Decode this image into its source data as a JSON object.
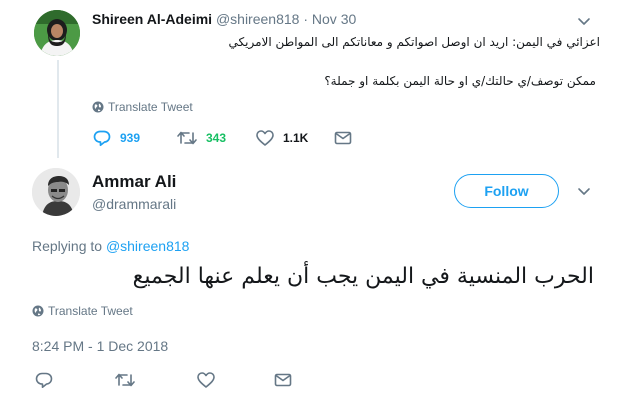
{
  "parent_tweet": {
    "author_name": "Shireen Al-Adeimi",
    "handle": "@shireen818",
    "separator": "·",
    "date": "Nov 30",
    "text_line1": "اعزائي في اليمن: اريد ان اوصل اصواتكم و معاناتكم الى المواطن الامريكي",
    "text_line2": "ممكن توصف/ي حالتك/ي او حالة اليمن بكلمة او جملة؟",
    "translate_label": "Translate Tweet",
    "replies": "939",
    "retweets": "343",
    "likes": "1.1K"
  },
  "main_tweet": {
    "author_name": "Ammar Ali",
    "handle": "@drammarali",
    "follow_label": "Follow",
    "replying_prefix": "Replying to",
    "replying_handle": "@shireen818",
    "text": "الحرب المنسية في اليمن يجب أن يعلم عنها الجميع",
    "translate_label": "Translate Tweet",
    "datetime": "8:24 PM - 1 Dec 2018"
  },
  "colors": {
    "accent": "#1da1f2",
    "muted": "#657786",
    "text": "#14171a",
    "line": "#e1e8ed"
  }
}
